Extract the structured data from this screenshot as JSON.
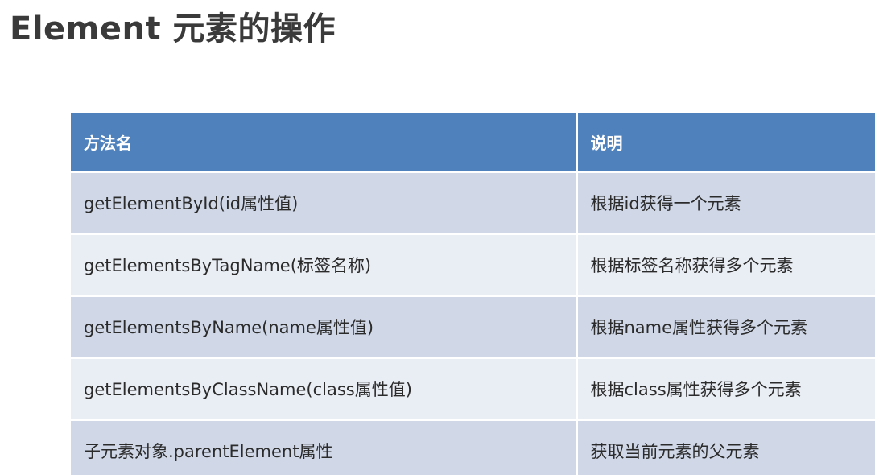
{
  "slide": {
    "title": "Element 元素的操作"
  },
  "table": {
    "headers": [
      "方法名",
      "说明"
    ],
    "rows": [
      {
        "method": "getElementById(id属性值)",
        "description": "根据id获得一个元素"
      },
      {
        "method": "getElementsByTagName(标签名称)",
        "description": "根据标签名称获得多个元素"
      },
      {
        "method": "getElementsByName(name属性值)",
        "description": "根据name属性获得多个元素"
      },
      {
        "method": "getElementsByClassName(class属性值)",
        "description": "根据class属性获得多个元素"
      },
      {
        "method": "子元素对象.parentElement属性",
        "description": "获取当前元素的父元素"
      }
    ]
  },
  "colors": {
    "header_bg": "#4f81bd",
    "row_odd_bg": "#d0d8e8",
    "row_even_bg": "#e9edf4"
  }
}
